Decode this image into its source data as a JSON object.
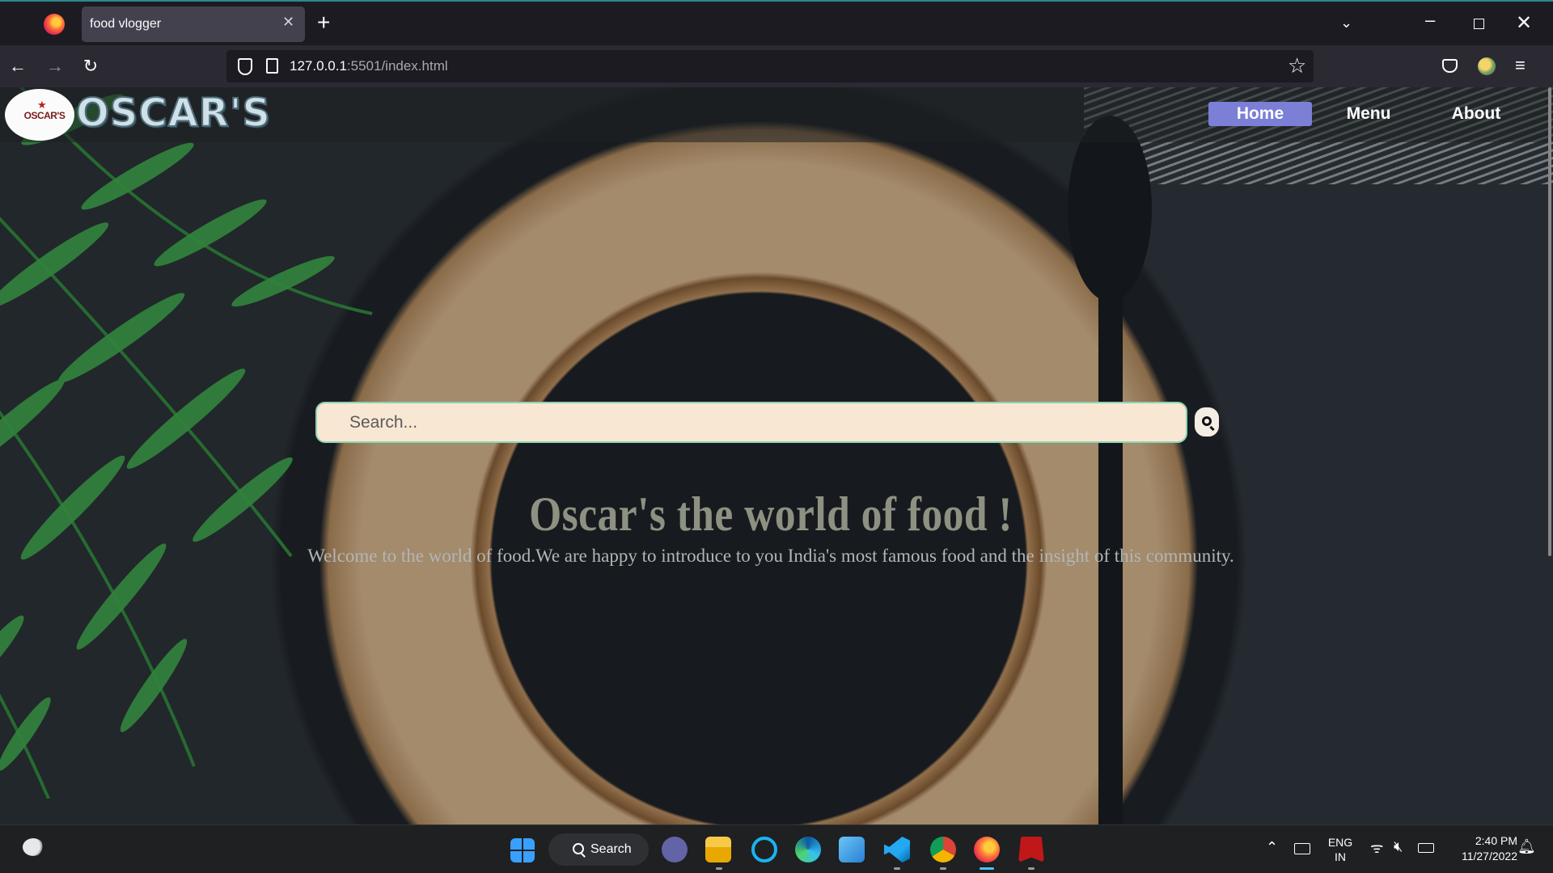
{
  "browser": {
    "tab_title": "food vlogger",
    "url_host": "127.0.0.1",
    "url_rest": ":5501/index.html"
  },
  "site": {
    "badge_text": "OSCAR'S",
    "brand_name": "OSCAR'S",
    "nav": [
      {
        "label": "Home",
        "active": true
      },
      {
        "label": "Menu",
        "active": false
      },
      {
        "label": "About",
        "active": false
      }
    ],
    "search_placeholder": "Search...",
    "hero_title": "Oscar's the world of food !",
    "hero_subtitle": "Welcome to the world of food.We are happy to introduce to you India's most famous food and the insight of this community."
  },
  "taskbar": {
    "search_label": "Search",
    "lang_line1": "ENG",
    "lang_line2": "IN",
    "time": "2:40 PM",
    "date": "11/27/2022"
  },
  "colors": {
    "nav_active_bg": "#7b7fd6",
    "search_bg": "#f8e7d3",
    "hero_title": "#8c9182"
  }
}
